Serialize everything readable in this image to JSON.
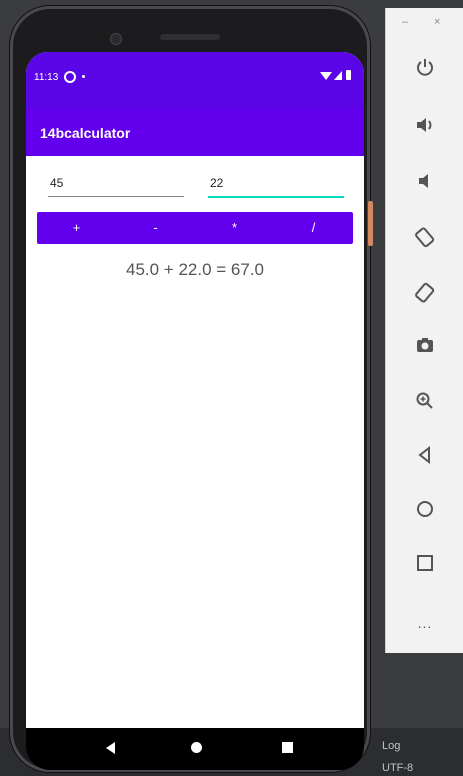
{
  "status_bar": {
    "time": "11:13"
  },
  "app": {
    "title": "14bcalculator"
  },
  "inputs": {
    "first_value": "45",
    "second_value": "22"
  },
  "operators": [
    "+",
    "-",
    "*",
    "/"
  ],
  "result": "45.0 + 22.0 = 67.0",
  "emulator_toolbar": {
    "window_controls": [
      "–",
      "×"
    ],
    "tools": [
      "power-icon",
      "volume-up-icon",
      "volume-down-icon",
      "rotate-left-icon",
      "rotate-right-icon",
      "camera-icon",
      "zoom-icon",
      "back-icon",
      "home-icon",
      "overview-icon",
      "more-icon"
    ],
    "more_label": "..."
  },
  "ide_status": {
    "log_label": "Log",
    "encoding": "UTF-8"
  },
  "colors": {
    "primary": "#6200ee",
    "status_bar": "#5b06e6",
    "accent": "#03dac5"
  }
}
